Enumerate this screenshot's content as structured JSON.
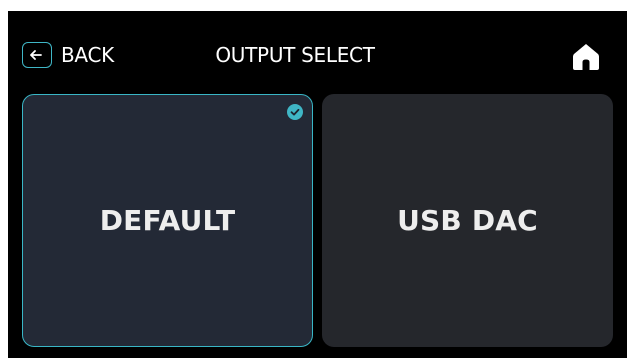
{
  "header": {
    "back_label": "BACK",
    "title": "OUTPUT SELECT",
    "back_icon": "arrow-left-icon",
    "home_icon": "home-icon"
  },
  "outputs": [
    {
      "label": "DEFAULT",
      "selected": true
    },
    {
      "label": "USB DAC",
      "selected": false
    }
  ],
  "colors": {
    "accent": "#3fb6c6",
    "background": "#000000",
    "tile_selected": "#232936",
    "tile": "#25272c",
    "text": "#ffffff"
  }
}
